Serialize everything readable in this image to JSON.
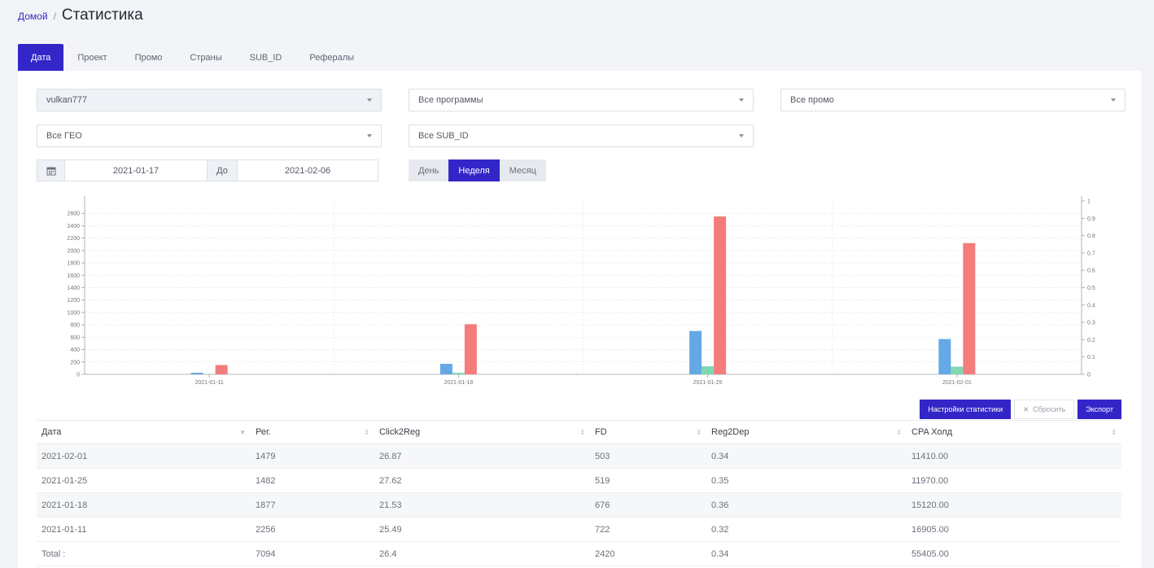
{
  "breadcrumb": {
    "home": "Домой",
    "separator": "/",
    "title": "Статистика"
  },
  "tabs": [
    {
      "label": "Дата",
      "active": true
    },
    {
      "label": "Проект",
      "active": false
    },
    {
      "label": "Промо",
      "active": false
    },
    {
      "label": "Страны",
      "active": false
    },
    {
      "label": "SUB_ID",
      "active": false
    },
    {
      "label": "Рефералы",
      "active": false
    }
  ],
  "filters": {
    "account": "vulkan777",
    "programs": "Все программы",
    "promo": "Все промо",
    "geo": "Все ГЕО",
    "subid": "Все SUB_ID"
  },
  "daterange": {
    "from": "2021-01-17",
    "to_label": "До",
    "to": "2021-02-06"
  },
  "period": {
    "day": "День",
    "week": "Неделя",
    "month": "Месяц",
    "active": "week"
  },
  "chart_data": {
    "type": "bar",
    "categories": [
      "2021-01-11",
      "2021-01-18",
      "2021-01-25",
      "2021-02-01"
    ],
    "series": [
      {
        "color": "#64a8e6",
        "values": [
          25,
          170,
          700,
          570
        ]
      },
      {
        "color": "#80d8b0",
        "values": [
          5,
          25,
          130,
          125
        ]
      },
      {
        "color": "#f47c7c",
        "values": [
          150,
          810,
          2550,
          2120
        ]
      }
    ],
    "ylim": [
      0,
      2800
    ],
    "yticks": [
      "0",
      "200",
      "400",
      "600",
      "800",
      "1000",
      "1200",
      "1400",
      "1600",
      "1800",
      "2000",
      "2200",
      "2400",
      "2600"
    ],
    "y2lim": [
      0,
      1
    ],
    "y2ticks": [
      "0",
      "0.1",
      "0.2",
      "0.3",
      "0.4",
      "0.5",
      "0.6",
      "0.7",
      "0.8",
      "0.9",
      "1"
    ],
    "grid": true
  },
  "actions": {
    "settings": "Настройки статистики",
    "reset": "Сбросить",
    "export": "Экспорт"
  },
  "table": {
    "headers": [
      "Дата",
      "Рег.",
      "Click2Reg",
      "FD",
      "Reg2Dep",
      "CPA Холд"
    ],
    "rows": [
      [
        "2021-02-01",
        "1479",
        "26.87",
        "503",
        "0.34",
        "11410.00"
      ],
      [
        "2021-01-25",
        "1482",
        "27.62",
        "519",
        "0.35",
        "11970.00"
      ],
      [
        "2021-01-18",
        "1877",
        "21.53",
        "676",
        "0.36",
        "15120.00"
      ],
      [
        "2021-01-11",
        "2256",
        "25.49",
        "722",
        "0.32",
        "16905.00"
      ]
    ],
    "total": [
      "Total :",
      "7094",
      "26.4",
      "2420",
      "0.34",
      "55405.00"
    ]
  }
}
